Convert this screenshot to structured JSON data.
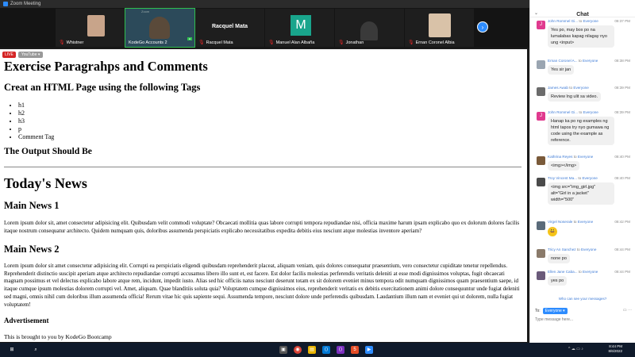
{
  "window": {
    "title": "Zoom Meeting"
  },
  "participants": [
    {
      "name": "Whistner"
    },
    {
      "name": "KodeGo Accounts 2",
      "zoom_label": "Zoom"
    },
    {
      "name": "Racquel Mata",
      "big_name": "Racquel Mata"
    },
    {
      "name": "Manuel Alan Albaña",
      "avatar_letter": "M"
    },
    {
      "name": "Jonathan"
    },
    {
      "name": "Ernan Coronel Albia"
    }
  ],
  "shared": {
    "live_label": "LIVE",
    "youtube_label": "YouTube ▾",
    "heading": "Exercise Paragrahps and Comments",
    "subheading": "Creat an HTML Page using the following Tags",
    "tags": [
      "h1",
      "h2",
      "h3",
      "p",
      "Comment Tag"
    ],
    "output_heading": "The Output Should Be",
    "news_title": "Today's News",
    "news1_title": "Main News 1",
    "news1_text": "Lorem ipsum dolor sit, amet consectetur adipisicing elit. Quibusdam velit commodi voluptate? Obcaecati mollitia quas labore corrupti tempora repudiandae nisi, officia maxime harum ipsam explicabo quo ex dolorum dolores facilis itaque nostrum consequatur architecto. Quidem numquam quis, doloribus assumenda perspiciatis explicabo necessitatibus expedita debitis eius nesciunt atque molestias inventore aperiam?",
    "news2_title": "Main News 2",
    "news2_text": "Lorem ipsum dolor sit amet consectetur adipisicing elit. Corrupti ea perspiciatis eligendi quibusdam reprehenderit placeat, aliquam veniam, quis dolores consequatur praesentium, vero consectetur cupiditate tenetur repellendus. Reprehenderit distinctio suscipit aperiam atque architecto repudiandae corrupti accusamus libero illo sunt et, est facere. Est dolor facilis molestias perferendis veritatis deleniti at esse modi dignissimos voluptas, fugit obcaecati magnam possimus et vel delectus explicabo labore atque rem, incidunt, impedit iusto. Alias sed hic officiis natus nesciunt deserunt totam ex sit dolorem eveniet minus tempora odit numquam dignissimos quam praesentium saepe, id itaque cumque ipsum molestias dolorem corrupti vel. Amet, aliquam. Quae blanditiis soluta quia? Voluptatem cumque dignissimos eius, reprehenderit veritatis ex debitis exercitationem animi dolore consequuntur unde fugiat deleniti sed magni, omnis nihil cum doloribus illum assumenda officia! Rerum vitae hic quis sapiente sequi. Assumenda tempore, nesciunt dolore unde perferendis quibusdam. Laudantium illum nam et eveniet qui ut dolorem, nulla fugiat voluptatem!",
    "advert_title": "Advertisement",
    "footer_text": "This is brought to you by KodeGo Bootcamp"
  },
  "chat": {
    "title": "Chat",
    "to_label": "to",
    "messages": [
      {
        "sender": "John Rommel Gi...",
        "to": "Everyone",
        "time": "08:37 PM",
        "initial": "J",
        "color": "#e03a8f",
        "text": "Yes po, may box po na lumalabas kapag nilagay nyo ung <input>"
      },
      {
        "sender": "Ernan Coronel A...",
        "to": "Everyone",
        "time": "08:38 PM",
        "initial": "",
        "color": "#9aa5b1",
        "text": "Yes sir jan"
      },
      {
        "sender": "James Awab",
        "to": "Everyone",
        "time": "08:39 PM",
        "initial": "",
        "color": "#6b6b6b",
        "text": "Review lng ulit sa video."
      },
      {
        "sender": "John Rommel Gi...",
        "to": "Everyone",
        "time": "08:39 PM",
        "initial": "J",
        "color": "#e03a8f",
        "text": "Hanap ka po ng examples ng html tapos try nyo gumawa ng code using the example as reference."
      },
      {
        "sender": "Kathrina Reyes",
        "to": "Everyone",
        "time": "08:40 PM",
        "initial": "",
        "color": "#7a5a3a",
        "text": "<img></img>"
      },
      {
        "sender": "Troy Vincent Ma...",
        "to": "Everyone",
        "time": "08:40 PM",
        "initial": "",
        "color": "#4a4a4a",
        "text": "<img src=\"img_girl.jpg\" alt=\"Girl in a jacket\" width=\"500\""
      },
      {
        "sender": "Virgel Noserale",
        "to": "Everyone",
        "time": "08:42 PM",
        "initial": "",
        "color": "#5a6b7a",
        "text": "😃"
      },
      {
        "sender": "Tricy An Sanchez",
        "to": "Everyone",
        "time": "08:44 PM",
        "initial": "",
        "color": "#8a7a6a",
        "text": "none po"
      },
      {
        "sender": "Ellen Jane Caba...",
        "to": "Everyone",
        "time": "08:44 PM",
        "initial": "",
        "color": "#6a5a7a",
        "text": "yes po"
      }
    ],
    "who_can_see": "Who can see your messages?",
    "to_field": "To:",
    "recipient": "Everyone ▾",
    "input_placeholder": "Type message here..."
  },
  "taskbar": {
    "time": "8:44 PM",
    "date": "8/6/2022"
  }
}
